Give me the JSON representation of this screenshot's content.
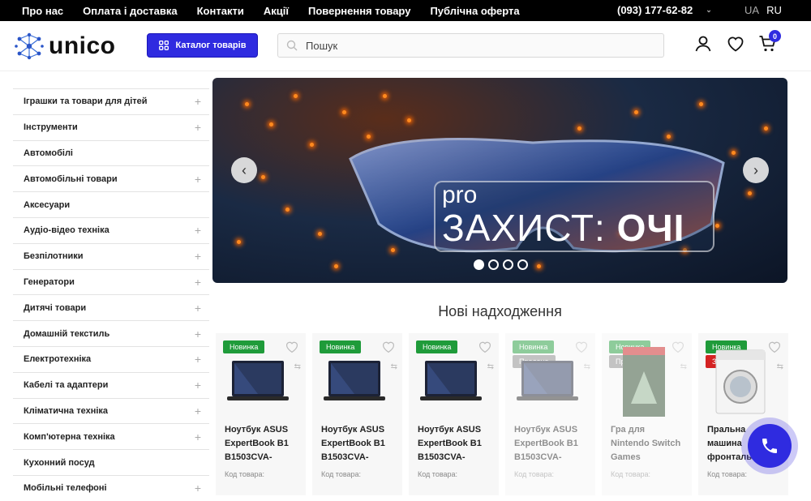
{
  "topbar": {
    "nav": [
      "Про нас",
      "Оплата і доставка",
      "Контакти",
      "Акції",
      "Повернення товару",
      "Публічна оферта"
    ],
    "phone": "(093) 177-62-82",
    "lang": [
      "UA",
      "RU"
    ]
  },
  "header": {
    "logo_text": "unico",
    "catalog_label": "Каталог товарів",
    "search_placeholder": "Пошук",
    "cart_count": "0"
  },
  "sidebar": {
    "items": [
      {
        "label": "Іграшки та товари для дітей",
        "expandable": true
      },
      {
        "label": "Інструменти",
        "expandable": true
      },
      {
        "label": "Автомобілі",
        "expandable": false
      },
      {
        "label": "Автомобільні товари",
        "expandable": true
      },
      {
        "label": "Аксесуари",
        "expandable": false
      },
      {
        "label": "Аудіо-відео техніка",
        "expandable": true
      },
      {
        "label": "Безпілотники",
        "expandable": true
      },
      {
        "label": "Генератори",
        "expandable": true
      },
      {
        "label": "Дитячі товари",
        "expandable": true
      },
      {
        "label": "Домашній текстиль",
        "expandable": true
      },
      {
        "label": "Електротехніка",
        "expandable": true
      },
      {
        "label": "Кабелі та адаптери",
        "expandable": true
      },
      {
        "label": "Кліматична техніка",
        "expandable": true
      },
      {
        "label": "Комп'ютерна техніка",
        "expandable": true
      },
      {
        "label": "Кухонний посуд",
        "expandable": false
      },
      {
        "label": "Мобільні телефоні",
        "expandable": true
      }
    ]
  },
  "banner": {
    "pro": "pro",
    "headline_light": "ЗАХИСТ:",
    "headline_bold": "ОЧІ",
    "slides": 4,
    "active_slide": 1
  },
  "new_arrivals": {
    "title": "Нові надходження",
    "products": [
      {
        "badge": "Новинка",
        "status": "",
        "name": "Ноутбук ASUS ExpertBook B1 B1503CVA-",
        "code": "Код товара:",
        "image": "laptop-icon",
        "faded": false
      },
      {
        "badge": "Новинка",
        "status": "",
        "name": "Ноутбук ASUS ExpertBook B1 B1503CVA-",
        "code": "Код товара:",
        "image": "laptop-icon",
        "faded": false
      },
      {
        "badge": "Новинка",
        "status": "",
        "name": "Ноутбук ASUS ExpertBook B1 B1503CVA-",
        "code": "Код товара:",
        "image": "laptop-icon",
        "faded": false
      },
      {
        "badge": "Новинка",
        "status": "Продано",
        "name": "Ноутбук ASUS ExpertBook B1 B1503CVA-",
        "code": "Код товара:",
        "image": "laptop-icon",
        "faded": true
      },
      {
        "badge": "Новинка",
        "status": "Продано",
        "name": "Гра для Nintendo Switch Games",
        "code": "Код товара:",
        "image": "game-cover-icon",
        "faded": true
      },
      {
        "badge": "Новинка",
        "status": "Закінчується",
        "name": "Пральна машина фронтальн",
        "code": "Код товара:",
        "image": "washing-machine-icon",
        "faded": false
      }
    ]
  },
  "colors": {
    "accent": "#2f2be0",
    "new_badge": "#1f9b3a",
    "ending_badge": "#d42222"
  }
}
